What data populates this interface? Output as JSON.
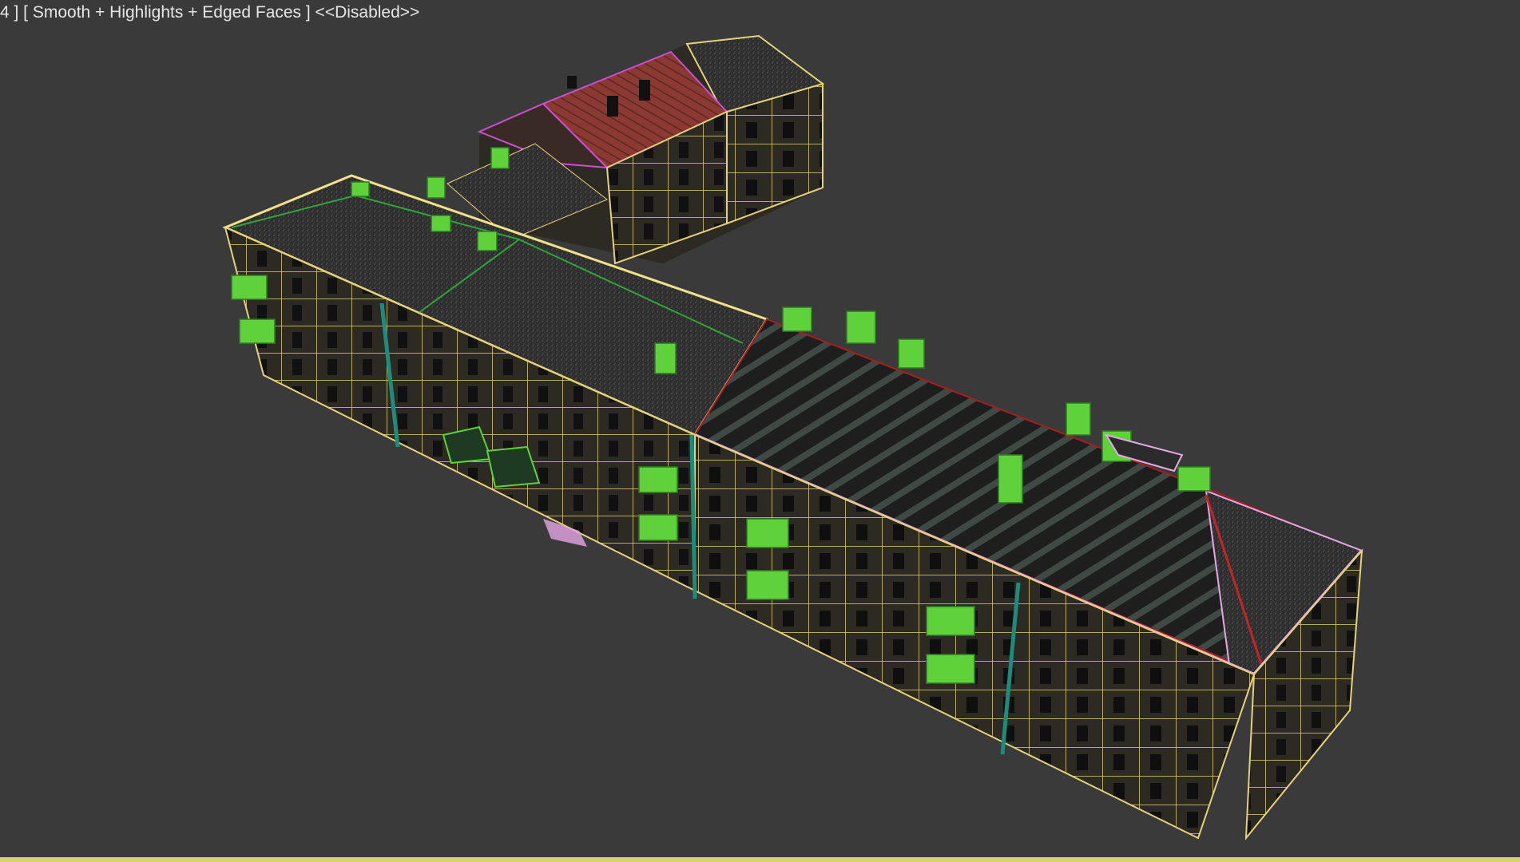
{
  "viewport": {
    "label": "4 ] [ Smooth + Highlights + Edged Faces ] <<Disabled>>",
    "background": "#3a3a3a",
    "active_border_color": "#d7d36a"
  },
  "scene": {
    "object": "apartment-building-model",
    "wireframe_color": "#e6d27a",
    "roof_color": "#2a2a2a",
    "red_roof_color": "#8a3a32",
    "balcony_color": "#5fd13a",
    "drainpipe_color": "#1e8c7a",
    "cornice_highlight_color": "#e7a6e6"
  }
}
